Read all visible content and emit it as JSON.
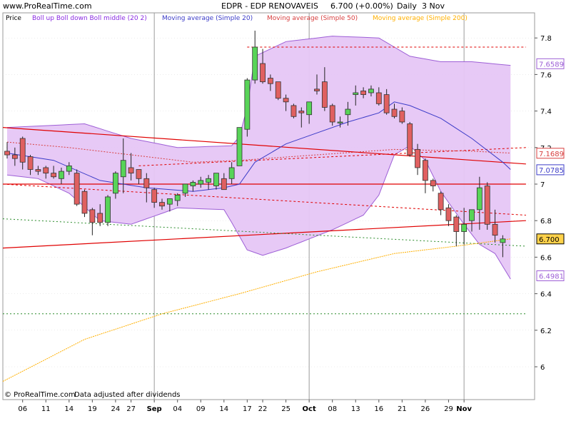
{
  "header": {
    "site": "www.ProRealTime.com",
    "title": "EDPR - EDP RENOVAVEIS",
    "price_change": "6.700 (+0.00%)",
    "period": "Daily",
    "date": "3 Nov"
  },
  "footer": {
    "copyright": "© ProRealTime.com",
    "note": "Data adjusted after dividends"
  },
  "colors": {
    "background": "#ffffff",
    "bollinger_fill": "#e6c6f5",
    "bollinger_edge": "#9d5fd6",
    "sma20": "#3c3cc8",
    "sma50": "#d84040",
    "sma200": "#ffb000",
    "up_candle": "#58d458",
    "down_candle": "#e06060",
    "trendline": "#e00000",
    "support_dotted": "#2a8c2a",
    "grid": "#d8d8d8"
  },
  "legend": [
    {
      "label": "Price",
      "color": "#000000"
    },
    {
      "label": "Boll up Boll down Boll middle (20 2)",
      "color": "#8a2be2"
    },
    {
      "label": "Moving average (Simple 20)",
      "color": "#3c3cc8"
    },
    {
      "label": "Moving average (Simple 50)",
      "color": "#d84040"
    },
    {
      "label": "Moving average (Simple 200)",
      "color": "#ffb000"
    }
  ],
  "chart_data": {
    "type": "candlestick",
    "title": "EDPR - EDP RENOVAVEIS",
    "ylim": [
      5.85,
      7.95
    ],
    "y_ticks": [
      6,
      6.2,
      6.4,
      6.6,
      6.8,
      7,
      7.2,
      7.4,
      7.6,
      7.8
    ],
    "x_tick_labels": [
      "06",
      "11",
      "14",
      "19",
      "24",
      "27",
      "Sep",
      "04",
      "09",
      "14",
      "17",
      "22",
      "25",
      "Oct",
      "08",
      "13",
      "16",
      "21",
      "26",
      "29",
      "Nov"
    ],
    "price_labels": [
      {
        "label": "7.6589",
        "value": 7.6589,
        "color": "#9d5fd6"
      },
      {
        "label": "7.1689",
        "value": 7.1689,
        "color": "#d84040"
      },
      {
        "label": "7.0785",
        "value": 7.0785,
        "color": "#3c3cc8"
      },
      {
        "label": "6.700",
        "value": 6.7,
        "color": "#000000",
        "fill": "#ffd24a"
      },
      {
        "label": "6.4981",
        "value": 6.4981,
        "color": "#9d5fd6"
      }
    ],
    "candles": [
      {
        "o": 7.18,
        "h": 7.23,
        "l": 7.14,
        "c": 7.16
      },
      {
        "o": 7.16,
        "h": 7.2,
        "l": 7.1,
        "c": 7.14
      },
      {
        "o": 7.25,
        "h": 7.26,
        "l": 7.08,
        "c": 7.12
      },
      {
        "o": 7.15,
        "h": 7.16,
        "l": 7.05,
        "c": 7.08
      },
      {
        "o": 7.08,
        "h": 7.1,
        "l": 7.05,
        "c": 7.07
      },
      {
        "o": 7.09,
        "h": 7.1,
        "l": 7.03,
        "c": 7.06
      },
      {
        "o": 7.06,
        "h": 7.1,
        "l": 7.03,
        "c": 7.04
      },
      {
        "o": 7.03,
        "h": 7.09,
        "l": 7.0,
        "c": 7.07
      },
      {
        "o": 7.07,
        "h": 7.12,
        "l": 7.05,
        "c": 7.1
      },
      {
        "o": 7.06,
        "h": 7.08,
        "l": 6.88,
        "c": 6.89
      },
      {
        "o": 6.96,
        "h": 6.97,
        "l": 6.82,
        "c": 6.84
      },
      {
        "o": 6.86,
        "h": 6.87,
        "l": 6.72,
        "c": 6.79
      },
      {
        "o": 6.84,
        "h": 6.89,
        "l": 6.77,
        "c": 6.79
      },
      {
        "o": 6.79,
        "h": 6.94,
        "l": 6.77,
        "c": 6.93
      },
      {
        "o": 6.95,
        "h": 7.07,
        "l": 6.92,
        "c": 7.06
      },
      {
        "o": 7.04,
        "h": 7.25,
        "l": 6.95,
        "c": 7.13
      },
      {
        "o": 7.09,
        "h": 7.17,
        "l": 7.02,
        "c": 7.06
      },
      {
        "o": 7.08,
        "h": 7.08,
        "l": 7.0,
        "c": 7.03
      },
      {
        "o": 7.03,
        "h": 7.06,
        "l": 6.9,
        "c": 6.98
      },
      {
        "o": 6.97,
        "h": 6.98,
        "l": 6.87,
        "c": 6.9
      },
      {
        "o": 6.9,
        "h": 6.92,
        "l": 6.86,
        "c": 6.88
      },
      {
        "o": 6.89,
        "h": 6.92,
        "l": 6.85,
        "c": 6.92
      },
      {
        "o": 6.91,
        "h": 6.95,
        "l": 6.88,
        "c": 6.94
      },
      {
        "o": 6.95,
        "h": 7.0,
        "l": 6.93,
        "c": 7.0
      },
      {
        "o": 6.99,
        "h": 7.02,
        "l": 6.96,
        "c": 7.01
      },
      {
        "o": 7.0,
        "h": 7.04,
        "l": 6.98,
        "c": 7.02
      },
      {
        "o": 7.01,
        "h": 7.05,
        "l": 6.97,
        "c": 7.03
      },
      {
        "o": 6.99,
        "h": 7.06,
        "l": 6.97,
        "c": 7.06
      },
      {
        "o": 7.03,
        "h": 7.06,
        "l": 6.97,
        "c": 6.97
      },
      {
        "o": 7.03,
        "h": 7.12,
        "l": 7.0,
        "c": 7.09
      },
      {
        "o": 7.1,
        "h": 7.31,
        "l": 7.1,
        "c": 7.31
      },
      {
        "o": 7.3,
        "h": 7.58,
        "l": 7.26,
        "c": 7.57
      },
      {
        "o": 7.57,
        "h": 7.84,
        "l": 7.55,
        "c": 7.75
      },
      {
        "o": 7.66,
        "h": 7.74,
        "l": 7.55,
        "c": 7.56
      },
      {
        "o": 7.58,
        "h": 7.6,
        "l": 7.51,
        "c": 7.55
      },
      {
        "o": 7.56,
        "h": 7.56,
        "l": 7.46,
        "c": 7.47
      },
      {
        "o": 7.47,
        "h": 7.49,
        "l": 7.4,
        "c": 7.45
      },
      {
        "o": 7.43,
        "h": 7.44,
        "l": 7.36,
        "c": 7.37
      },
      {
        "o": 7.4,
        "h": 7.42,
        "l": 7.31,
        "c": 7.39
      },
      {
        "o": 7.38,
        "h": 7.45,
        "l": 7.33,
        "c": 7.45
      },
      {
        "o": 7.52,
        "h": 7.6,
        "l": 7.49,
        "c": 7.51
      },
      {
        "o": 7.56,
        "h": 7.64,
        "l": 7.4,
        "c": 7.42
      },
      {
        "o": 7.43,
        "h": 7.44,
        "l": 7.32,
        "c": 7.34
      },
      {
        "o": 7.34,
        "h": 7.37,
        "l": 7.31,
        "c": 7.34
      },
      {
        "o": 7.38,
        "h": 7.45,
        "l": 7.32,
        "c": 7.41
      },
      {
        "o": 7.49,
        "h": 7.54,
        "l": 7.43,
        "c": 7.5
      },
      {
        "o": 7.51,
        "h": 7.53,
        "l": 7.47,
        "c": 7.49
      },
      {
        "o": 7.5,
        "h": 7.54,
        "l": 7.48,
        "c": 7.52
      },
      {
        "o": 7.5,
        "h": 7.53,
        "l": 7.43,
        "c": 7.44
      },
      {
        "o": 7.49,
        "h": 7.52,
        "l": 7.38,
        "c": 7.39
      },
      {
        "o": 7.41,
        "h": 7.44,
        "l": 7.36,
        "c": 7.37
      },
      {
        "o": 7.4,
        "h": 7.42,
        "l": 7.33,
        "c": 7.34
      },
      {
        "o": 7.33,
        "h": 7.34,
        "l": 7.15,
        "c": 7.16
      },
      {
        "o": 7.19,
        "h": 7.22,
        "l": 7.05,
        "c": 7.09
      },
      {
        "o": 7.13,
        "h": 7.14,
        "l": 6.95,
        "c": 7.02
      },
      {
        "o": 7.02,
        "h": 7.03,
        "l": 6.96,
        "c": 6.99
      },
      {
        "o": 6.95,
        "h": 6.96,
        "l": 6.83,
        "c": 6.86
      },
      {
        "o": 6.87,
        "h": 6.89,
        "l": 6.77,
        "c": 6.8
      },
      {
        "o": 6.82,
        "h": 6.83,
        "l": 6.66,
        "c": 6.74
      },
      {
        "o": 6.74,
        "h": 6.87,
        "l": 6.67,
        "c": 6.78
      },
      {
        "o": 6.8,
        "h": 6.86,
        "l": 6.74,
        "c": 6.86
      },
      {
        "o": 6.86,
        "h": 7.04,
        "l": 6.75,
        "c": 6.98
      },
      {
        "o": 6.99,
        "h": 7.01,
        "l": 6.75,
        "c": 6.78
      },
      {
        "o": 6.78,
        "h": 6.86,
        "l": 6.68,
        "c": 6.72
      },
      {
        "o": 6.68,
        "h": 6.72,
        "l": 6.6,
        "c": 6.7
      }
    ],
    "boll_upper": [
      [
        0,
        7.31
      ],
      [
        10,
        7.33
      ],
      [
        16,
        7.25
      ],
      [
        22,
        7.2
      ],
      [
        29,
        7.21
      ],
      [
        30,
        7.26
      ],
      [
        31,
        7.42
      ],
      [
        32,
        7.7
      ],
      [
        36,
        7.78
      ],
      [
        42,
        7.81
      ],
      [
        48,
        7.8
      ],
      [
        52,
        7.7
      ],
      [
        56,
        7.67
      ],
      [
        60,
        7.67
      ],
      [
        65,
        7.65
      ]
    ],
    "boll_lower": [
      [
        0,
        7.05
      ],
      [
        4,
        7.03
      ],
      [
        8,
        6.95
      ],
      [
        12,
        6.8
      ],
      [
        16,
        6.78
      ],
      [
        22,
        6.87
      ],
      [
        28,
        6.86
      ],
      [
        29,
        6.79
      ],
      [
        31,
        6.64
      ],
      [
        33,
        6.61
      ],
      [
        36,
        6.65
      ],
      [
        42,
        6.75
      ],
      [
        46,
        6.83
      ],
      [
        48,
        6.94
      ],
      [
        50,
        7.16
      ],
      [
        52,
        7.21
      ],
      [
        54,
        7.13
      ],
      [
        56,
        6.96
      ],
      [
        59,
        6.78
      ],
      [
        61,
        6.67
      ],
      [
        63,
        6.62
      ],
      [
        65,
        6.48
      ]
    ],
    "boll_middle": [
      [
        0,
        7.17
      ],
      [
        6,
        7.13
      ],
      [
        12,
        7.02
      ],
      [
        18,
        6.98
      ],
      [
        24,
        6.96
      ],
      [
        28,
        6.98
      ],
      [
        30,
        7.0
      ],
      [
        32,
        7.12
      ],
      [
        36,
        7.22
      ],
      [
        40,
        7.28
      ],
      [
        44,
        7.34
      ],
      [
        48,
        7.39
      ],
      [
        50,
        7.45
      ],
      [
        52,
        7.43
      ],
      [
        56,
        7.36
      ],
      [
        60,
        7.25
      ],
      [
        64,
        7.12
      ],
      [
        65,
        7.08
      ]
    ],
    "sma20": [
      [
        0,
        7.17
      ],
      [
        6,
        7.13
      ],
      [
        12,
        7.02
      ],
      [
        18,
        6.98
      ],
      [
        24,
        6.96
      ],
      [
        28,
        6.98
      ],
      [
        30,
        7.0
      ],
      [
        32,
        7.12
      ],
      [
        36,
        7.22
      ],
      [
        40,
        7.28
      ],
      [
        44,
        7.34
      ],
      [
        48,
        7.39
      ],
      [
        50,
        7.45
      ],
      [
        52,
        7.43
      ],
      [
        56,
        7.36
      ],
      [
        60,
        7.25
      ],
      [
        64,
        7.12
      ],
      [
        65,
        7.08
      ]
    ],
    "sma50": [
      [
        0,
        7.23
      ],
      [
        8,
        7.2
      ],
      [
        16,
        7.16
      ],
      [
        24,
        7.12
      ],
      [
        30,
        7.13
      ],
      [
        40,
        7.16
      ],
      [
        50,
        7.19
      ],
      [
        60,
        7.18
      ],
      [
        65,
        7.17
      ]
    ],
    "sma200": [
      [
        -1,
        5.92
      ],
      [
        10,
        6.15
      ],
      [
        20,
        6.29
      ],
      [
        30,
        6.4
      ],
      [
        40,
        6.52
      ],
      [
        50,
        6.62
      ],
      [
        58,
        6.66
      ],
      [
        65,
        6.7
      ]
    ],
    "trendlines": [
      {
        "style": "solid",
        "points": [
          [
            -1,
            7.31
          ],
          [
            67,
            7.11
          ]
        ]
      },
      {
        "style": "solid",
        "points": [
          [
            -1,
            7.0
          ],
          [
            67,
            7.0
          ]
        ]
      },
      {
        "style": "solid",
        "points": [
          [
            -1,
            6.65
          ],
          [
            67,
            6.8
          ]
        ]
      },
      {
        "style": "dashed",
        "points": [
          [
            31,
            7.75
          ],
          [
            67,
            7.75
          ]
        ]
      },
      {
        "style": "dashed",
        "points": [
          [
            -1,
            7.0
          ],
          [
            67,
            6.83
          ]
        ]
      },
      {
        "style": "dashed",
        "points": [
          [
            17,
            7.1
          ],
          [
            67,
            7.2
          ]
        ]
      },
      {
        "style": "dotted_green",
        "points": [
          [
            -1,
            6.81
          ],
          [
            67,
            6.66
          ]
        ]
      },
      {
        "style": "dotted_green",
        "points": [
          [
            -1,
            6.29
          ],
          [
            67,
            6.29
          ]
        ]
      }
    ],
    "x_tick_positions": [
      2,
      5,
      8,
      11,
      14,
      16,
      19,
      22,
      25,
      28,
      31,
      33,
      36,
      39,
      42,
      45,
      48,
      51,
      54,
      57,
      59
    ],
    "month_separators": [
      19,
      39,
      59
    ]
  }
}
